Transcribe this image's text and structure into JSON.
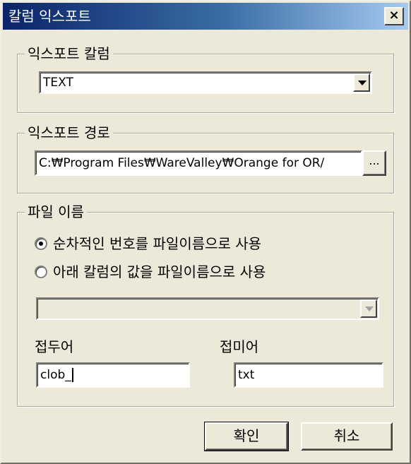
{
  "window": {
    "title": "칼럼 익스포트",
    "close_label": "×"
  },
  "export_column": {
    "group_label": "익스포트 칼럼",
    "selected": "TEXT"
  },
  "export_path": {
    "group_label": "익스포트 경로",
    "value": "C:₩Program Files₩WareValley₩Orange for OR/",
    "browse_label": "..."
  },
  "file_name": {
    "group_label": "파일 이름",
    "options": [
      {
        "label": "순차적인 번호를 파일이름으로 사용",
        "checked": true
      },
      {
        "label": "아래 칼럼의 값을 파일이름으로 사용",
        "checked": false
      }
    ],
    "column_select_value": "",
    "prefix_label": "접두어",
    "prefix_value": "clob_",
    "suffix_label": "접미어",
    "suffix_value": "txt"
  },
  "buttons": {
    "ok_label": "확인",
    "cancel_label": "취소"
  },
  "icons": {
    "close": "close-icon",
    "dropdown": "chevron-down-icon"
  }
}
